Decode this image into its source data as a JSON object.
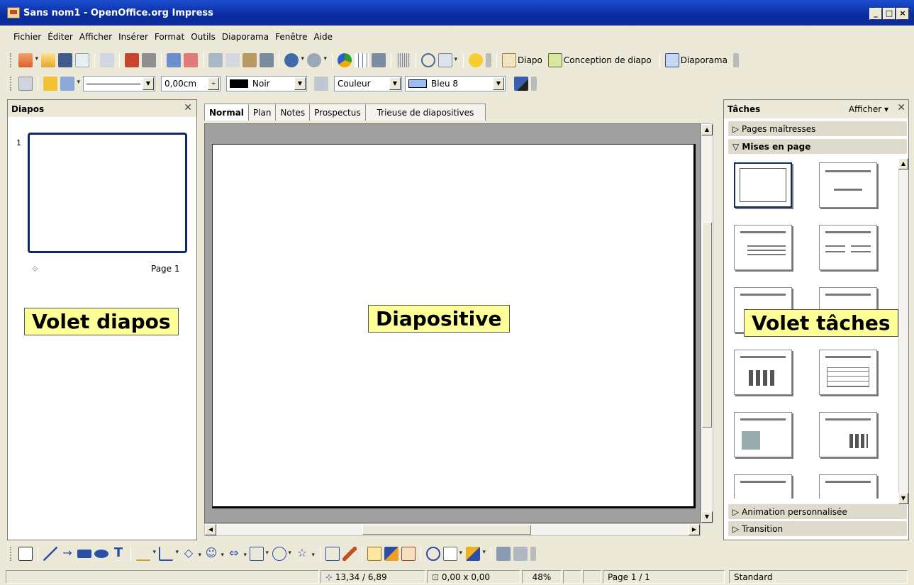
{
  "window": {
    "title": "Sans nom1 - OpenOffice.org Impress"
  },
  "menu": [
    "Fichier",
    "Éditer",
    "Afficher",
    "Insérer",
    "Format",
    "Outils",
    "Diaporama",
    "Fenêtre",
    "Aide"
  ],
  "toolbar1": {
    "diapo_label": "Diapo",
    "design_label": "Conception de diapo",
    "diaporama_label": "Diaporama"
  },
  "toolbar2": {
    "line_width": "0,00cm",
    "line_color": "Noir",
    "fill_type": "Couleur",
    "fill_color": "Bleu 8",
    "line_color_hex": "#000000",
    "fill_color_hex": "#9bbcf5"
  },
  "slides_pane": {
    "title": "Diapos",
    "slide_number": "1",
    "page_label": "Page 1"
  },
  "editor": {
    "tabs": [
      "Normal",
      "Plan",
      "Notes",
      "Prospectus",
      "Trieuse de diapositives"
    ],
    "active_tab": "Normal"
  },
  "tasks_pane": {
    "title": "Tâches",
    "view_label": "Afficher",
    "sections": {
      "master": "Pages maîtresses",
      "layouts": "Mises en page",
      "animation": "Animation personnalisée",
      "transition": "Transition"
    }
  },
  "callouts": {
    "slides": "Volet diapos",
    "slide": "Diapositive",
    "tasks": "Volet tâches"
  },
  "status": {
    "position": "13,34 / 6,89",
    "size": "0,00 x 0,00",
    "zoom": "48%",
    "page": "Page 1 / 1",
    "style": "Standard"
  }
}
